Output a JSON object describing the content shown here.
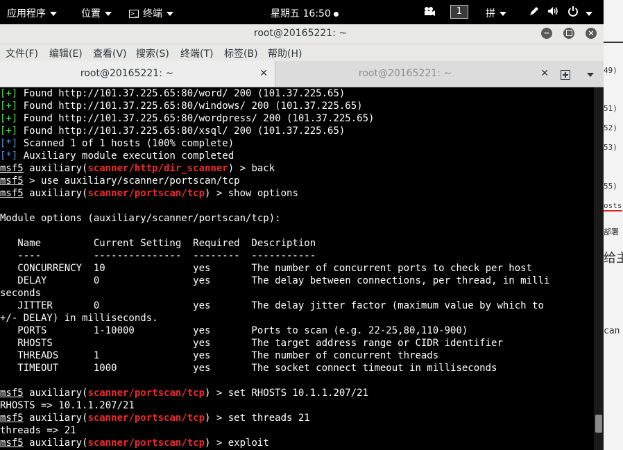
{
  "topbar": {
    "applications": "应用程序",
    "places": "位置",
    "terminal_app": "终端",
    "clock": "星期五 16:50",
    "workspace": "1",
    "input_method": "拼"
  },
  "window": {
    "title": "root@20165221: ~",
    "menus": [
      "文件(F)",
      "编辑(E)",
      "查看(V)",
      "搜索(S)",
      "终端(T)",
      "标签(B)",
      "帮助(H)"
    ],
    "tabs": [
      {
        "label": "root@20165221: ~",
        "active": true
      },
      {
        "label": "root@20165221: ~",
        "active": false
      }
    ]
  },
  "terminal": {
    "lines": [
      [
        {
          "t": "[+]",
          "c": "g"
        },
        {
          "t": " Found http://101.37.225.65:80/word/ 200 (101.37.225.65)"
        }
      ],
      [
        {
          "t": "[+]",
          "c": "g"
        },
        {
          "t": " Found http://101.37.225.65:80/windows/ 200 (101.37.225.65)"
        }
      ],
      [
        {
          "t": "[+]",
          "c": "g"
        },
        {
          "t": " Found http://101.37.225.65:80/wordpress/ 200 (101.37.225.65)"
        }
      ],
      [
        {
          "t": "[+]",
          "c": "g"
        },
        {
          "t": " Found http://101.37.225.65:80/xsql/ 200 (101.37.225.65)"
        }
      ],
      [
        {
          "t": "[*]",
          "c": "b"
        },
        {
          "t": " Scanned 1 of 1 hosts (100% complete)"
        }
      ],
      [
        {
          "t": "[*]",
          "c": "b"
        },
        {
          "t": " Auxiliary module execution completed"
        }
      ],
      [
        {
          "t": "msf5",
          "c": "u"
        },
        {
          "t": " auxiliary("
        },
        {
          "t": "scanner/http/dir_scanner",
          "c": "r"
        },
        {
          "t": ") > back"
        }
      ],
      [
        {
          "t": "msf5",
          "c": "u"
        },
        {
          "t": " > use auxiliary/scanner/portscan/tcp"
        }
      ],
      [
        {
          "t": "msf5",
          "c": "u"
        },
        {
          "t": " auxiliary("
        },
        {
          "t": "scanner/portscan/tcp",
          "c": "r"
        },
        {
          "t": ") > show options"
        }
      ],
      [
        {
          "t": ""
        }
      ],
      [
        {
          "t": "Module options (auxiliary/scanner/portscan/tcp):"
        }
      ],
      [
        {
          "t": ""
        }
      ],
      [
        {
          "t": "   Name         Current Setting  Required  Description"
        }
      ],
      [
        {
          "t": "   ----         ---------------  --------  -----------"
        }
      ],
      [
        {
          "t": "   CONCURRENCY  10               yes       The number of concurrent ports to check per host"
        }
      ],
      [
        {
          "t": "   DELAY        0                yes       The delay between connections, per thread, in milli"
        }
      ],
      [
        {
          "t": "seconds"
        }
      ],
      [
        {
          "t": "   JITTER       0                yes       The delay jitter factor (maximum value by which to "
        }
      ],
      [
        {
          "t": "+/- DELAY) in milliseconds."
        }
      ],
      [
        {
          "t": "   PORTS        1-10000          yes       Ports to scan (e.g. 22-25,80,110-900)"
        }
      ],
      [
        {
          "t": "   RHOSTS                        yes       The target address range or CIDR identifier"
        }
      ],
      [
        {
          "t": "   THREADS      1                yes       The number of concurrent threads"
        }
      ],
      [
        {
          "t": "   TIMEOUT      1000             yes       The socket connect timeout in milliseconds"
        }
      ],
      [
        {
          "t": ""
        }
      ],
      [
        {
          "t": "msf5",
          "c": "u"
        },
        {
          "t": " auxiliary("
        },
        {
          "t": "scanner/portscan/tcp",
          "c": "r"
        },
        {
          "t": ") > set RHOSTS 10.1.1.207/21"
        }
      ],
      [
        {
          "t": "RHOSTS => 10.1.1.207/21"
        }
      ],
      [
        {
          "t": "msf5",
          "c": "u"
        },
        {
          "t": " auxiliary("
        },
        {
          "t": "scanner/portscan/tcp",
          "c": "r"
        },
        {
          "t": ") > set threads 21"
        }
      ],
      [
        {
          "t": "threads => 21"
        }
      ],
      [
        {
          "t": "msf5",
          "c": "u"
        },
        {
          "t": " auxiliary("
        },
        {
          "t": "scanner/portscan/tcp",
          "c": "r"
        },
        {
          "t": ") > exploit"
        }
      ]
    ],
    "scroll_position": 0.95
  },
  "background_window": {
    "fragments": [
      "49)",
      "51)",
      "52)",
      "53)",
      "55)",
      "osts",
      "部署",
      "给主",
      "can"
    ]
  },
  "colors": {
    "found_marker": "#4ee44e",
    "info_marker": "#5a8fd6",
    "module_name": "#ef2929",
    "terminal_bg": "#000000"
  },
  "icons": [
    "activities-caret",
    "terminal-app-icon",
    "recording-indicator",
    "camera-icon",
    "input-method-caret",
    "pen-icon",
    "volume-icon",
    "power-icon",
    "minimize-icon",
    "maximize-icon",
    "close-icon",
    "tab-close-icon",
    "new-tab-icon",
    "tab-menu-caret"
  ]
}
